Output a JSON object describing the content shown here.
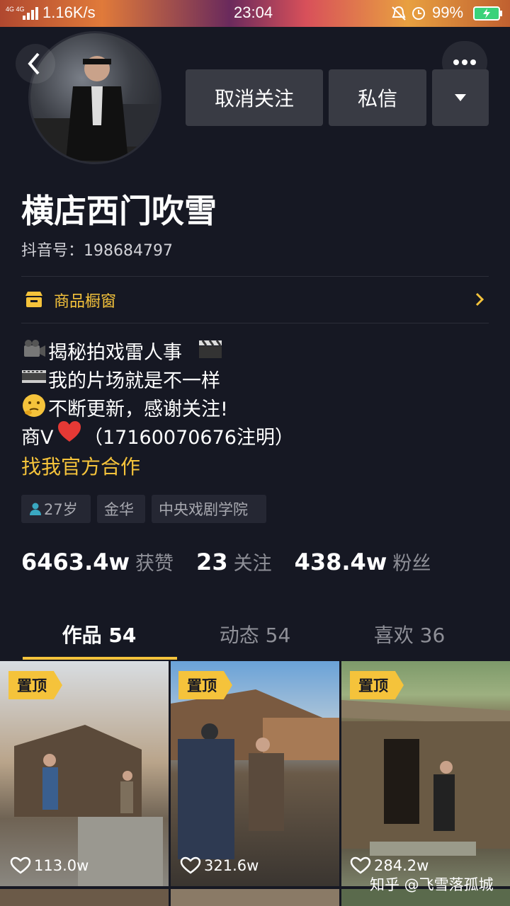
{
  "status_bar": {
    "network": "4G 4G",
    "speed": "1.16K/s",
    "time": "23:04",
    "battery": "99%"
  },
  "profile": {
    "name": "横店西门吹雪",
    "douyin_id": "抖音号：198684797",
    "unfollow_label": "取消关注",
    "message_label": "私信",
    "shop_label": "商品橱窗",
    "bio_lines": [
      "揭秘拍戏雷人事",
      "我的片场就是不一样",
      "不断更新，感谢关注!",
      "商V",
      "（17160070676注明）"
    ],
    "bio_link": "找我官方合作",
    "tags": [
      "27岁",
      "金华",
      "中央戏剧学院"
    ]
  },
  "stats": [
    {
      "value": "6463.4w",
      "label": "获赞"
    },
    {
      "value": "23",
      "label": "关注"
    },
    {
      "value": "438.4w",
      "label": "粉丝"
    }
  ],
  "tabs": [
    {
      "label": "作品 54"
    },
    {
      "label": "动态 54"
    },
    {
      "label": "喜欢 36"
    }
  ],
  "videos": [
    {
      "pin": "置顶",
      "likes": "113.0w"
    },
    {
      "pin": "置顶",
      "likes": "321.6w"
    },
    {
      "pin": "置顶",
      "likes": "284.2w"
    }
  ],
  "watermark": "知乎 @飞雪落孤城",
  "colors": {
    "accent": "#f5c33b",
    "background": "#161823"
  }
}
